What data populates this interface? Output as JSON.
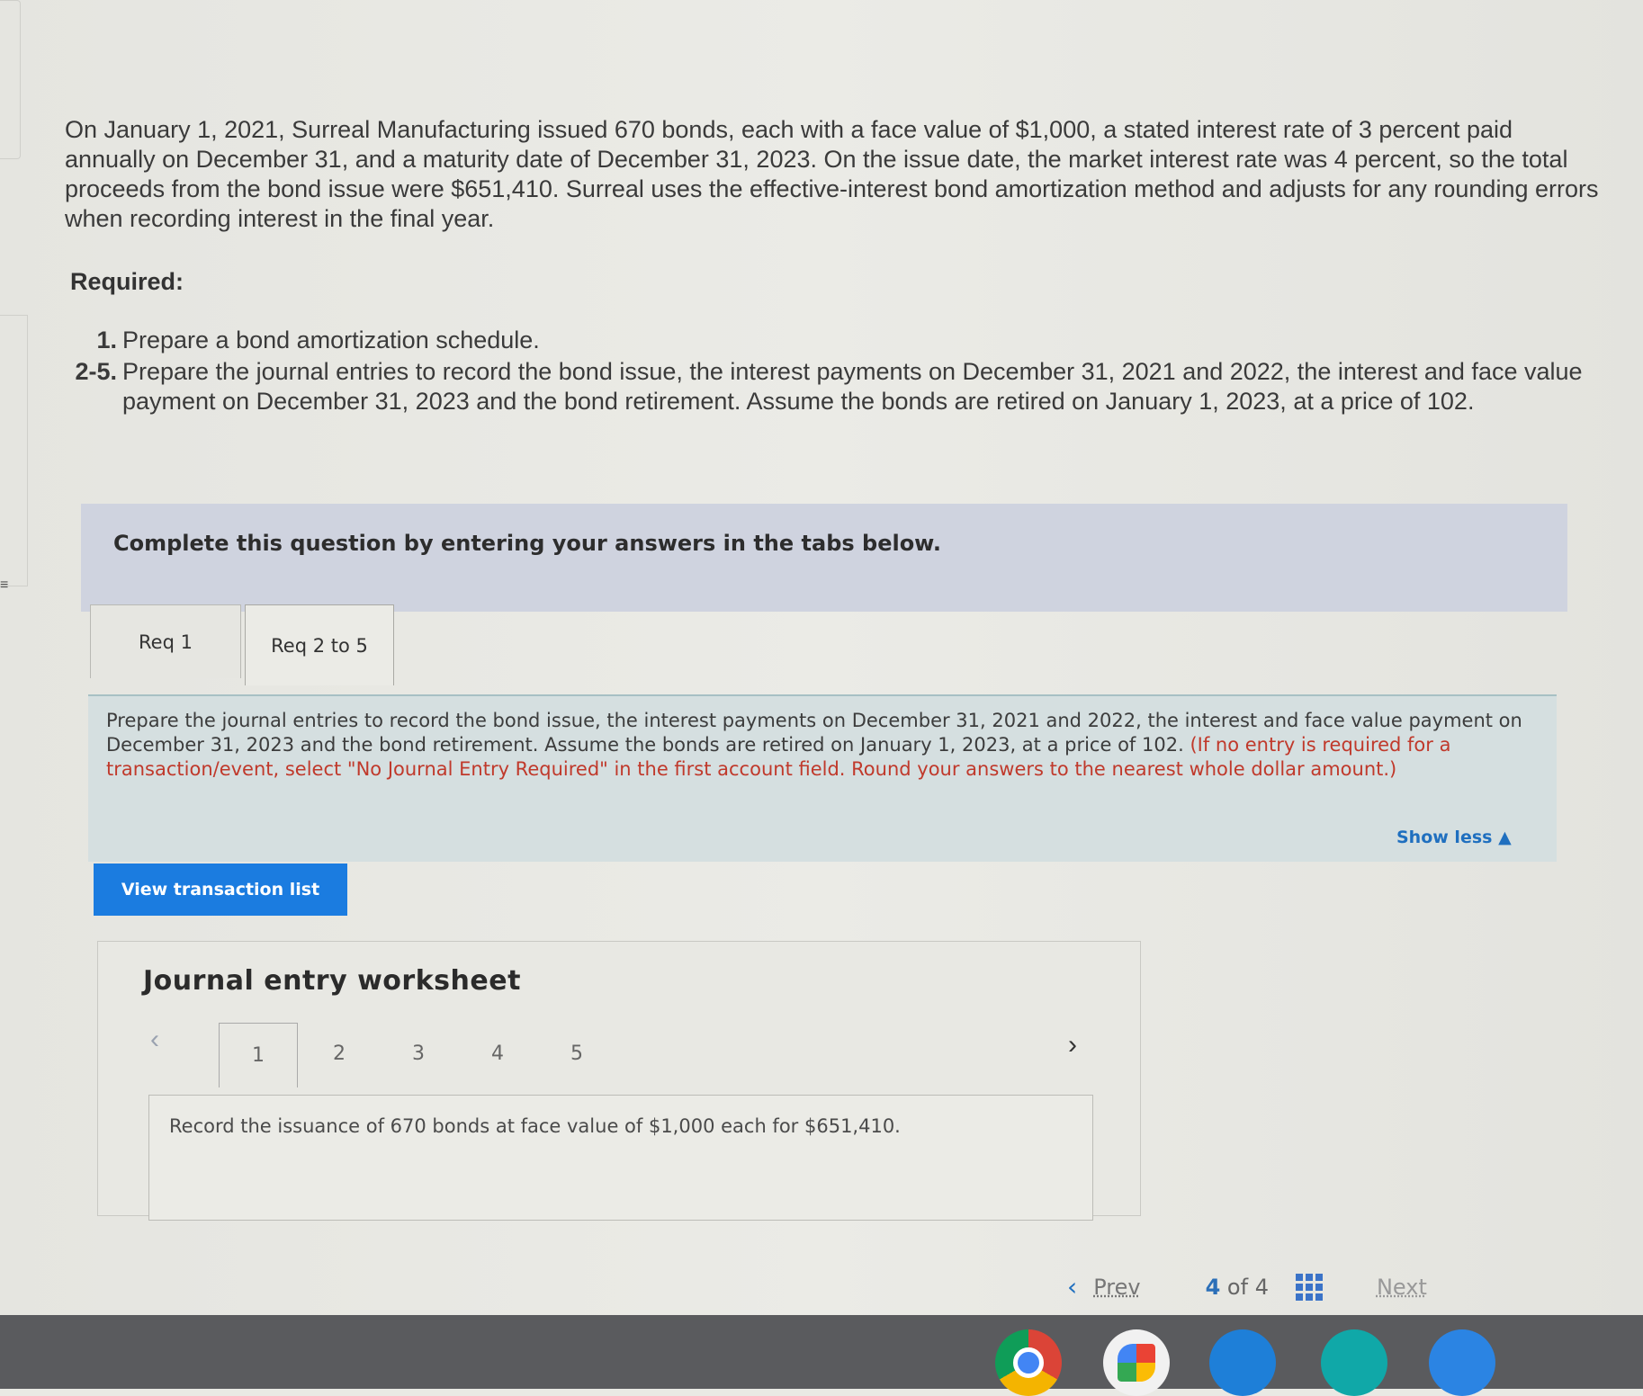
{
  "problem": {
    "text": "On January 1, 2021, Surreal Manufacturing issued 670 bonds, each with a face value of $1,000, a stated interest rate of 3 percent paid annually on December 31, and a maturity date of December 31, 2023. On the issue date, the market interest rate was 4 percent, so the total proceeds from the bond issue were $651,410. Surreal uses the effective-interest bond amortization method and adjusts for any rounding errors when recording interest in the final year."
  },
  "required": {
    "heading": "Required:",
    "items": [
      {
        "num": "1.",
        "text": "Prepare a bond amortization schedule."
      },
      {
        "num": "2-5.",
        "text": "Prepare the journal entries to record the bond issue, the interest payments on December 31, 2021 and 2022, the interest and face value payment on December 31, 2023 and the bond retirement. Assume the bonds are retired on January 1, 2023, at a price of 102."
      }
    ]
  },
  "banner": {
    "text": "Complete this question by entering your answers in the tabs below."
  },
  "tabs": [
    {
      "label": "Req 1"
    },
    {
      "label": "Req 2 to 5"
    }
  ],
  "instructions": {
    "main": "Prepare the journal entries to record the bond issue, the interest payments on December 31, 2021 and 2022, the interest and face value payment on December 31, 2023 and the bond retirement. Assume the bonds are retired on January 1, 2023, at a price of 102.",
    "note": "(If no entry is required for a transaction/event, select \"No Journal Entry Required\" in the first account field. Round your answers to the nearest whole dollar amount.)",
    "show_less": "Show less ▲"
  },
  "view_button": "View transaction list",
  "worksheet": {
    "title": "Journal entry worksheet",
    "tabs": [
      "1",
      "2",
      "3",
      "4",
      "5"
    ],
    "active_tab": "1",
    "description": "Record the issuance of 670 bonds at face value of $1,000 each for $651,410."
  },
  "pager": {
    "prev": "Prev",
    "current": "4",
    "of": "of",
    "total": "4",
    "next": "Next"
  },
  "icons": {
    "prev_chevron": "chevron-left-icon",
    "next_chevron": "chevron-right-icon",
    "grid": "grid-icon"
  }
}
